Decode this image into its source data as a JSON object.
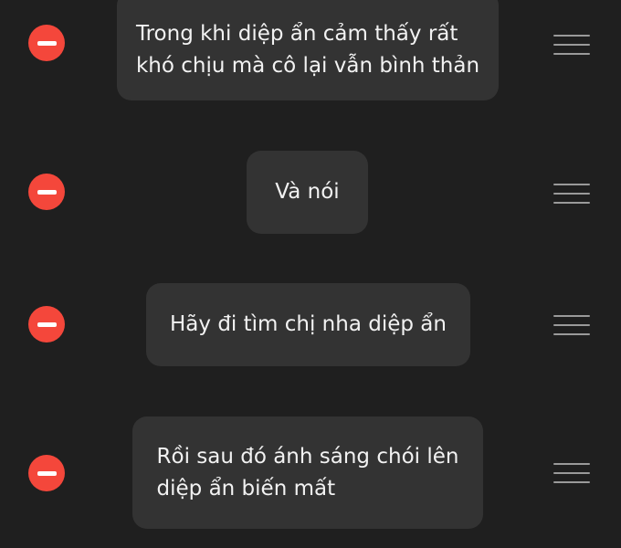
{
  "colors": {
    "background": "#1f1f1f",
    "bubble": "#333333",
    "text": "#f2f2f2",
    "delete": "#f4473b",
    "handle": "#9a9a9a"
  },
  "icons": {
    "delete": "minus-circle-icon",
    "reorder": "drag-handle-icon"
  },
  "items": [
    {
      "text": "Trong khi diệp ẩn cảm thấy rất\nkhó chịu mà cô lại vẫn bình thản"
    },
    {
      "text": "Và nói"
    },
    {
      "text": "Hãy đi tìm chị nha diệp ẩn"
    },
    {
      "text": "Rồi sau đó ánh sáng chói lên\ndiệp ẩn biến mất"
    }
  ]
}
